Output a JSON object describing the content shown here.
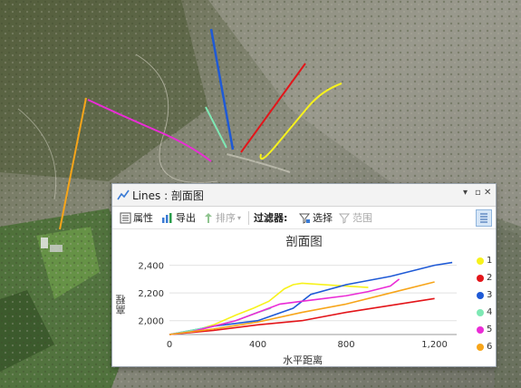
{
  "window": {
    "title": "Lines : 剖面图",
    "minimize_glyph": "▾",
    "close_glyph": "✕"
  },
  "toolbar": {
    "properties_label": "属性",
    "export_label": "导出",
    "sort_label": "排序",
    "filter_label": "过滤器:",
    "selection_label": "选择",
    "extent_label": "范围"
  },
  "colors": {
    "1": "#f7f21c",
    "2": "#e3151a",
    "3": "#1f5ad6",
    "4": "#7ee8b4",
    "5": "#ea2cd6",
    "6": "#f7a51a",
    "title_icon": "#3a7bd5"
  },
  "icons": [
    "line-chart-icon",
    "properties-icon",
    "export-icon",
    "sort-icon",
    "select-filter-icon",
    "extent-filter-icon",
    "panel-icon",
    "minimize-icon",
    "close-icon"
  ],
  "chart_data": {
    "type": "line",
    "title": "剖面图",
    "xlabel": "水平距离",
    "ylabel": "高程",
    "xlim": [
      0,
      1300
    ],
    "ylim": [
      1900,
      2450
    ],
    "xticks": [
      "0",
      "400",
      "800",
      "1,200"
    ],
    "yticks": [
      "2,000",
      "2,200",
      "2,400"
    ],
    "xtick_values": [
      0,
      400,
      800,
      1200
    ],
    "ytick_values": [
      2000,
      2200,
      2400
    ],
    "grid": "horizontal",
    "legend": "right",
    "series": [
      {
        "name": "1",
        "x": [
          0,
          100,
          200,
          300,
          380,
          450,
          520,
          560,
          600,
          700,
          800,
          900
        ],
        "y": [
          1900,
          1920,
          1970,
          2040,
          2090,
          2140,
          2230,
          2260,
          2270,
          2260,
          2250,
          2240
        ]
      },
      {
        "name": "2",
        "x": [
          0,
          200,
          400,
          600,
          800,
          1000,
          1200
        ],
        "y": [
          1900,
          1930,
          1970,
          2000,
          2060,
          2110,
          2160
        ]
      },
      {
        "name": "3",
        "x": [
          0,
          200,
          400,
          560,
          640,
          800,
          1000,
          1100,
          1200,
          1280
        ],
        "y": [
          1900,
          1960,
          2000,
          2090,
          2190,
          2260,
          2320,
          2360,
          2400,
          2420
        ]
      },
      {
        "name": "4",
        "x": [
          0,
          100,
          200,
          300,
          400,
          460
        ],
        "y": [
          1900,
          1930,
          1960,
          2000,
          2060,
          2090
        ]
      },
      {
        "name": "5",
        "x": [
          0,
          100,
          200,
          300,
          400,
          500,
          600,
          700,
          800,
          900,
          1000,
          1040
        ],
        "y": [
          1900,
          1920,
          1960,
          2000,
          2060,
          2120,
          2140,
          2160,
          2180,
          2210,
          2250,
          2300
        ]
      },
      {
        "name": "6",
        "x": [
          0,
          200,
          400,
          600,
          800,
          1000,
          1200
        ],
        "y": [
          1900,
          1940,
          1990,
          2060,
          2120,
          2200,
          2280
        ]
      }
    ]
  }
}
